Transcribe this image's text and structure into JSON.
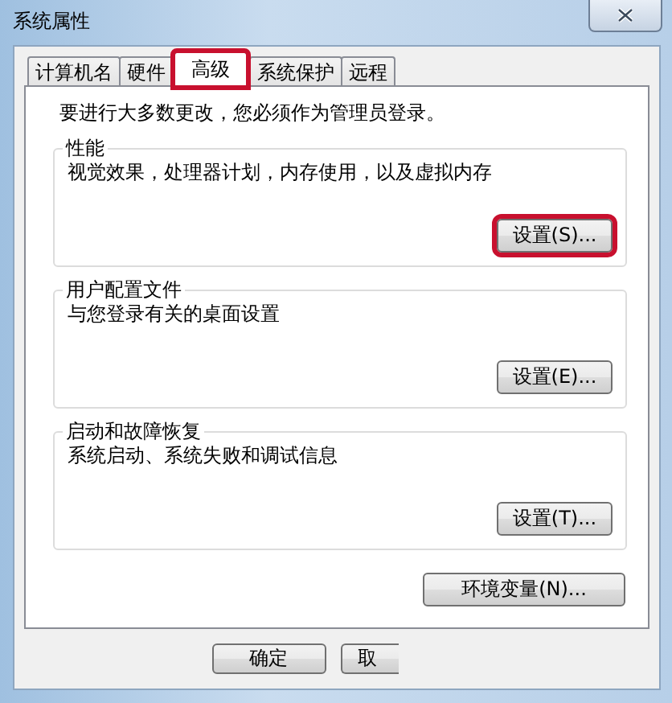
{
  "window": {
    "title": "系统属性"
  },
  "tabs": [
    {
      "label": "计算机名",
      "selected": false,
      "highlighted": false
    },
    {
      "label": "硬件",
      "selected": false,
      "highlighted": false
    },
    {
      "label": "高级",
      "selected": true,
      "highlighted": true
    },
    {
      "label": "系统保护",
      "selected": false,
      "highlighted": false
    },
    {
      "label": "远程",
      "selected": false,
      "highlighted": false
    }
  ],
  "notice": "要进行大多数更改，您必须作为管理员登录。",
  "groups": [
    {
      "title": "性能",
      "description": "视觉效果，处理器计划，内存使用，以及虚拟内存",
      "button": {
        "label": "设置(S)...",
        "highlighted": true
      }
    },
    {
      "title": "用户配置文件",
      "description": "与您登录有关的桌面设置",
      "button": {
        "label": "设置(E)...",
        "highlighted": false
      }
    },
    {
      "title": "启动和故障恢复",
      "description": "系统启动、系统失败和调试信息",
      "button": {
        "label": "设置(T)...",
        "highlighted": false
      }
    }
  ],
  "environment_button": {
    "label": "环境变量(N)...",
    "highlighted": false
  },
  "dialog_buttons": [
    {
      "label": "确定",
      "kind": "full"
    },
    {
      "label": "取",
      "kind": "cut"
    }
  ]
}
